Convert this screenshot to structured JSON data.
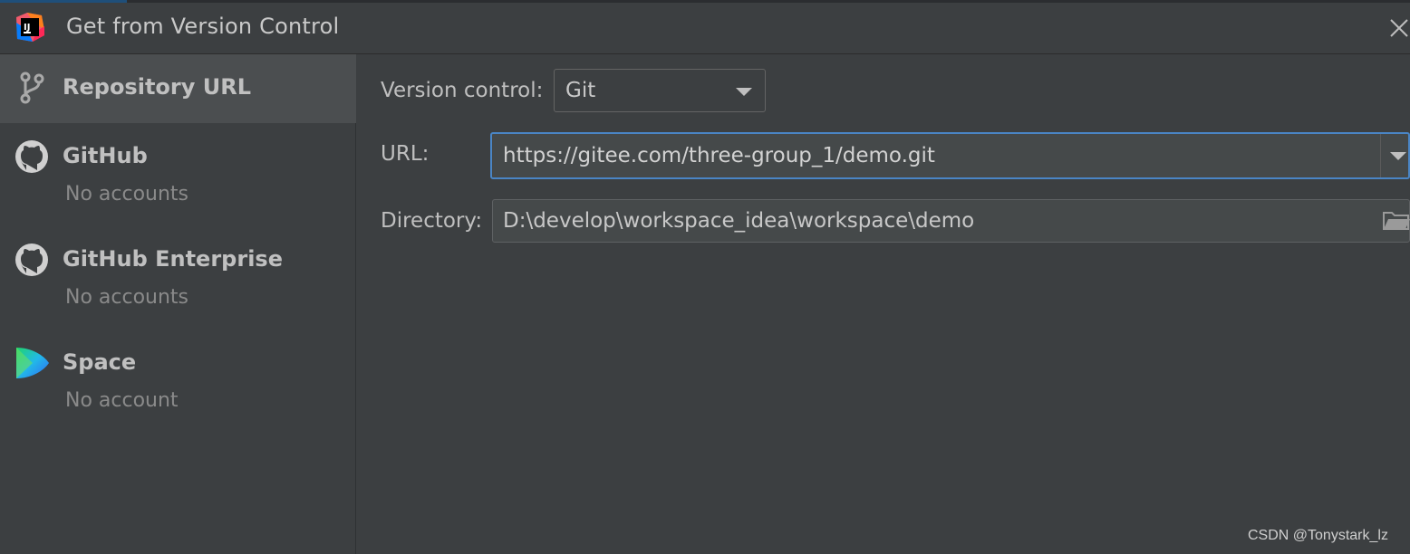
{
  "window": {
    "title": "Get from Version Control"
  },
  "sidebar": {
    "items": [
      {
        "label": "Repository URL",
        "sub": "",
        "icon": "branch-icon",
        "selected": true
      },
      {
        "label": "GitHub",
        "sub": "No accounts",
        "icon": "github-icon",
        "selected": false
      },
      {
        "label": "GitHub Enterprise",
        "sub": "No accounts",
        "icon": "github-icon",
        "selected": false
      },
      {
        "label": "Space",
        "sub": "No account",
        "icon": "space-icon",
        "selected": false
      }
    ]
  },
  "form": {
    "version_control_label": "Version control:",
    "version_control_value": "Git",
    "url_label": "URL:",
    "url_value": "https://gitee.com/three-group_1/demo.git",
    "directory_label": "Directory:",
    "directory_value": "D:\\develop\\workspace_idea\\workspace\\demo"
  },
  "watermark": "CSDN @Tonystark_lz",
  "colors": {
    "background": "#3c3f41",
    "selected_item": "#4b4e50",
    "focus_border": "#4a85c5"
  }
}
